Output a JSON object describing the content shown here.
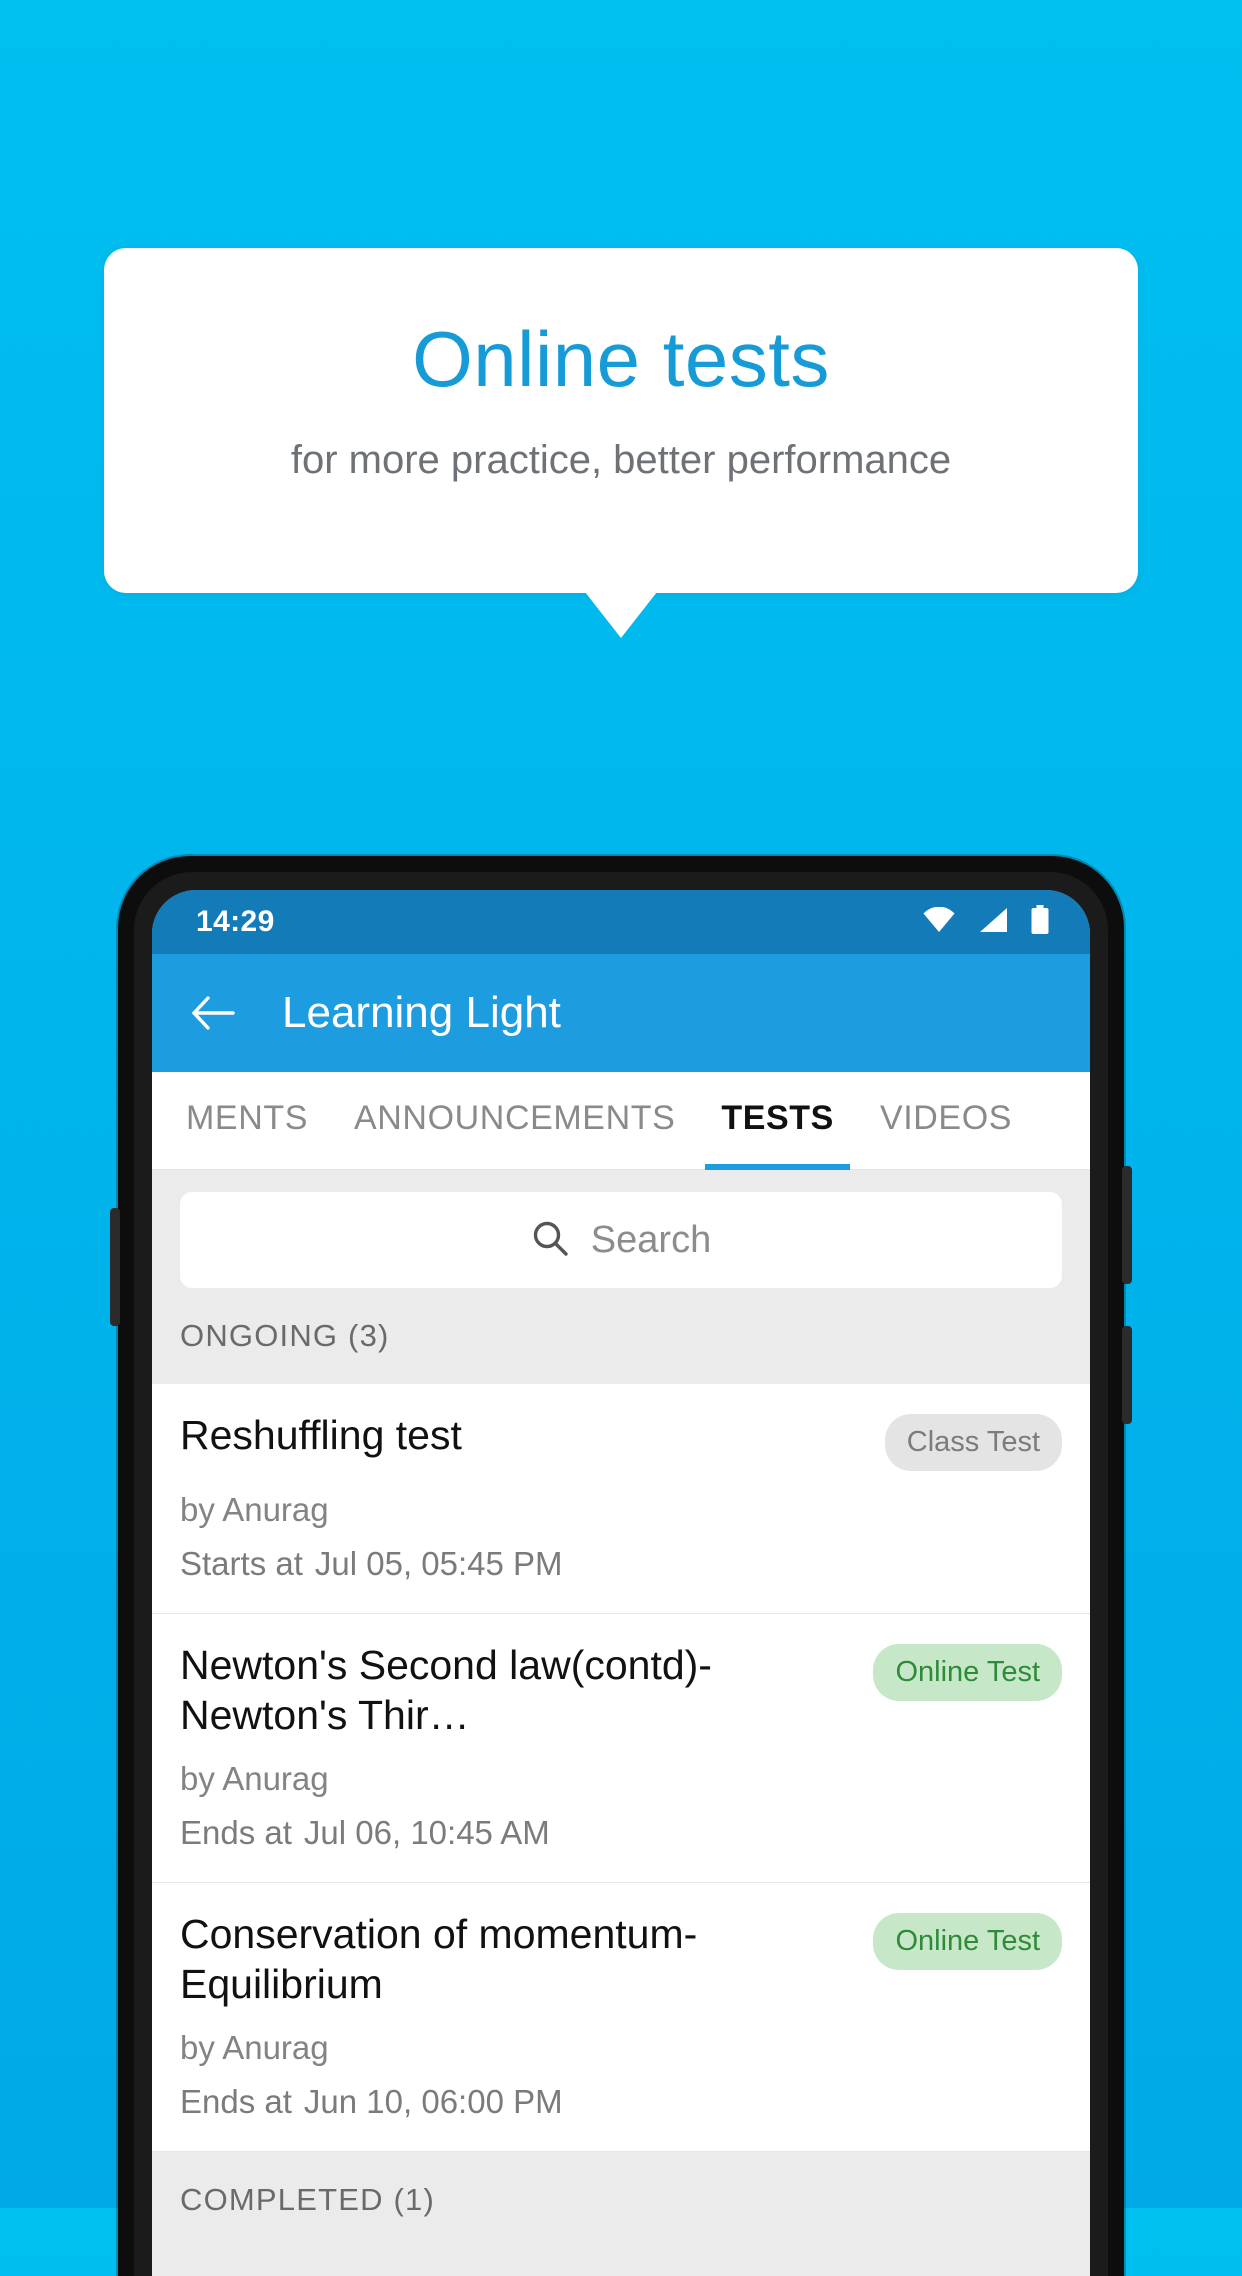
{
  "promo": {
    "title": "Online tests",
    "subtitle": "for more practice, better performance",
    "title_color": "#169BD7",
    "subtitle_color": "#6E7276",
    "background_color": "#00B5EC"
  },
  "phone": {
    "status_bar": {
      "time": "14:29",
      "icons": [
        "wifi-icon",
        "signal-icon",
        "battery-icon"
      ],
      "background_color": "#147BB9"
    },
    "app_bar": {
      "back_icon": "back-arrow-icon",
      "title": "Learning Light",
      "background_color": "#1E9CE0"
    },
    "tabs": [
      {
        "label": "MENTS",
        "active": false
      },
      {
        "label": "ANNOUNCEMENTS",
        "active": false
      },
      {
        "label": "TESTS",
        "active": true
      },
      {
        "label": "VIDEOS",
        "active": false
      }
    ],
    "search": {
      "icon": "search-icon",
      "placeholder": "Search",
      "value": ""
    },
    "sections": [
      {
        "header": "ONGOING (3)",
        "items": [
          {
            "title": "Reshuffling test",
            "badge": "Class Test",
            "badge_type": "grey",
            "author": "by Anurag",
            "time_label": "Starts at",
            "time_value": "Jul 05, 05:45 PM"
          },
          {
            "title": "Newton's Second law(contd)-Newton's Thir…",
            "badge": "Online Test",
            "badge_type": "green",
            "author": "by Anurag",
            "time_label": "Ends at",
            "time_value": "Jul 06, 10:45 AM"
          },
          {
            "title": "Conservation of momentum-Equilibrium",
            "badge": "Online Test",
            "badge_type": "green",
            "author": "by Anurag",
            "time_label": "Ends at",
            "time_value": "Jun 10, 06:00 PM"
          }
        ]
      },
      {
        "header": "COMPLETED (1)",
        "items": []
      }
    ]
  }
}
